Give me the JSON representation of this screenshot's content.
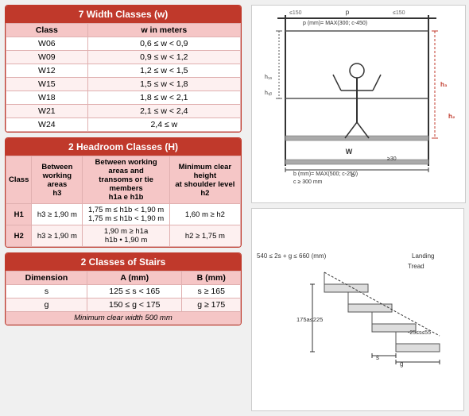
{
  "width_classes": {
    "title": "7 Width Classes (w)",
    "col1": "Class",
    "col2": "w in meters",
    "rows": [
      {
        "class": "W06",
        "range": "0,6 ≤ w < 0,9"
      },
      {
        "class": "W09",
        "range": "0,9 ≤ w < 1,2"
      },
      {
        "class": "W12",
        "range": "1,2 ≤ w < 1,5"
      },
      {
        "class": "W15",
        "range": "1,5 ≤ w < 1,8"
      },
      {
        "class": "W18",
        "range": "1,8 ≤ w < 2,1"
      },
      {
        "class": "W21",
        "range": "2,1 ≤ w < 2,4"
      },
      {
        "class": "W24",
        "range": "2,4 ≤ w"
      }
    ]
  },
  "headroom_classes": {
    "title": "2 Headroom Classes (H)",
    "col_class": "Class",
    "col_between": "Between working areas h3",
    "col_transoms": "Between working areas and transoms or tie members h1a e h1b",
    "col_shoulder": "Minimum clear height at shoulder level h2",
    "rows": [
      {
        "class": "H1",
        "between": "h3 ≥ 1,90 m",
        "transoms": "1,75 m ≤ h1b < 1,90 m\n1,75 m ≤ h1b < 1,90 m",
        "shoulder": "1,60 m ≥ h2"
      },
      {
        "class": "H2",
        "between": "h3 ≥ 1,90 m",
        "transoms": "1,90 m ≥ h1a\nh1b • 1,90 m",
        "shoulder": "h2 ≥ 1,75 m"
      }
    ]
  },
  "stairs_classes": {
    "title": "2 Classes of Stairs",
    "col_dim": "Dimension",
    "col_a": "A (mm)",
    "col_b": "B (mm)",
    "rows": [
      {
        "dim": "s",
        "a": "125 ≤ s < 165",
        "b": "s ≥ 165"
      },
      {
        "dim": "g",
        "a": "150 ≤ g < 175",
        "b": "g ≥ 175"
      }
    ],
    "min_clear": "Minimum clear width 500 mm"
  }
}
